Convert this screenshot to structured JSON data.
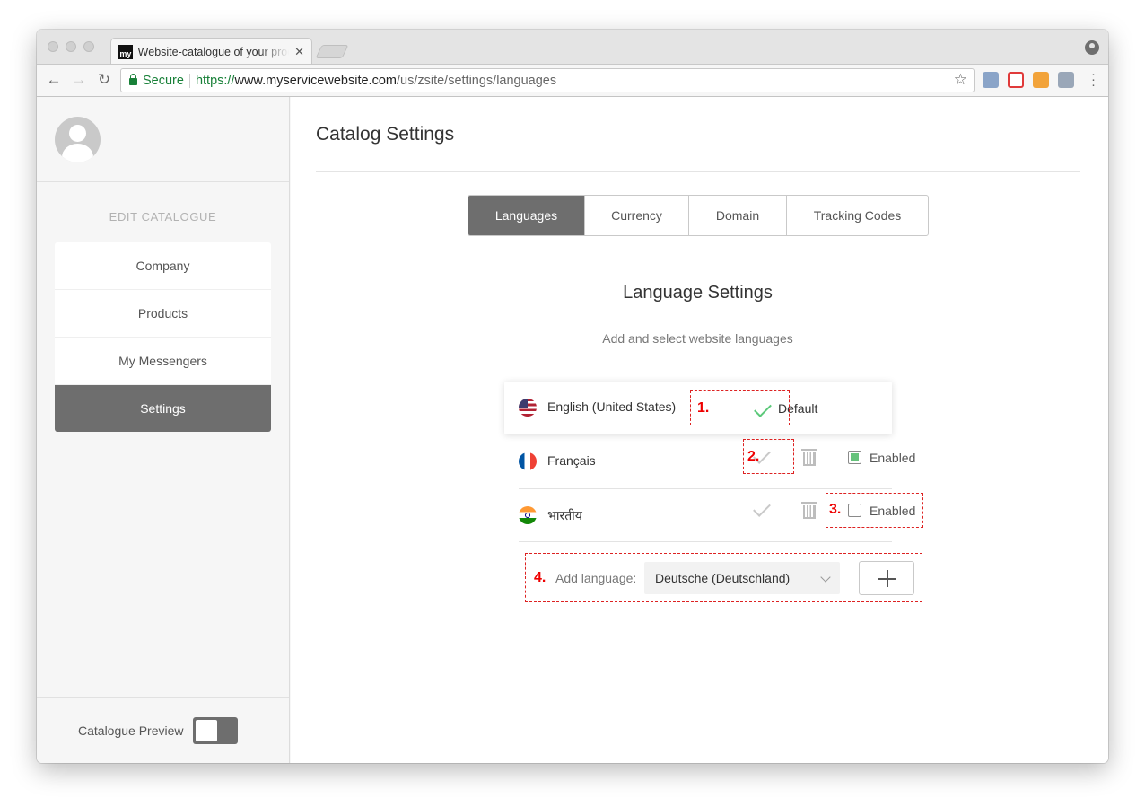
{
  "browser": {
    "tab_title": "Website-catalogue of your products",
    "url_secure_label": "Secure",
    "url_scheme": "https://",
    "url_host": "www.myservicewebsite.com",
    "url_path": "/us/zsite/settings/languages"
  },
  "sidebar": {
    "section_label": "EDIT CATALOGUE",
    "items": [
      {
        "label": "Company"
      },
      {
        "label": "Products"
      },
      {
        "label": "My Messengers"
      },
      {
        "label": "Settings"
      }
    ],
    "preview_label": "Catalogue Preview",
    "preview_on": false
  },
  "main": {
    "title": "Catalog Settings",
    "tabs": [
      {
        "label": "Languages",
        "active": true
      },
      {
        "label": "Currency",
        "active": false
      },
      {
        "label": "Domain",
        "active": false
      },
      {
        "label": "Tracking Codes",
        "active": false
      }
    ],
    "section_title": "Language Settings",
    "section_subtitle": "Add and select website languages",
    "languages": [
      {
        "name": "English (United States)",
        "flag": "us-flag-icon",
        "default_label": "Default",
        "is_default": true
      },
      {
        "name": "Français",
        "flag": "fr-flag-icon",
        "enabled_label": "Enabled",
        "enabled": true
      },
      {
        "name": "भारतीय",
        "flag": "in-flag-icon",
        "enabled_label": "Enabled",
        "enabled": false
      }
    ],
    "add_label": "Add language:",
    "add_selected": "Deutsche (Deutschland)",
    "annotations": [
      "1.",
      "2.",
      "3.",
      "4."
    ]
  },
  "colors": {
    "accent_dark": "#6e6e6e",
    "check_green": "#5cc97a",
    "annotation_red": "#dd2222",
    "secure_green": "#188038"
  }
}
